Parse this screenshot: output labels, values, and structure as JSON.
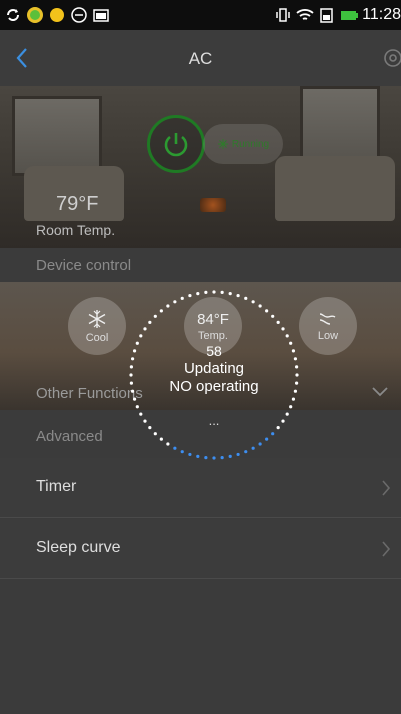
{
  "status_bar": {
    "time": "11:28",
    "icons": [
      "sync-icon",
      "app-badge-icon",
      "yellow-dot-icon",
      "face-icon",
      "image-icon",
      "vibrate-icon",
      "wifi-icon",
      "sim-icon",
      "battery-icon"
    ]
  },
  "header": {
    "title": "AC",
    "back_icon": "chevron-left-icon",
    "settings_icon": "gear-icon"
  },
  "hero": {
    "power_icon": "power-icon",
    "status_badge": "Running",
    "room_temp": "79°F",
    "room_temp_label": "Room Temp."
  },
  "device_control": {
    "section_label": "Device control",
    "mode": {
      "label": "Cool",
      "icon": "snowflake-icon"
    },
    "temperature": {
      "value": "84°F",
      "label": "Temp."
    },
    "fan": {
      "label": "Low",
      "icon": "wind-icon"
    }
  },
  "other_functions": {
    "label": "Other Functions"
  },
  "advanced": {
    "section_label": "Advanced",
    "items": [
      {
        "label": "Timer"
      },
      {
        "label": "Sleep curve"
      }
    ]
  },
  "loading": {
    "count": "58",
    "status_line1": "Updating",
    "status_line2": "NO operating",
    "ellipsis": "..."
  },
  "colors": {
    "accent_green": "#1f7a24",
    "spinner_white": "#ffffff",
    "spinner_blue": "#3d8ef0",
    "background": "#3b3b3b"
  }
}
